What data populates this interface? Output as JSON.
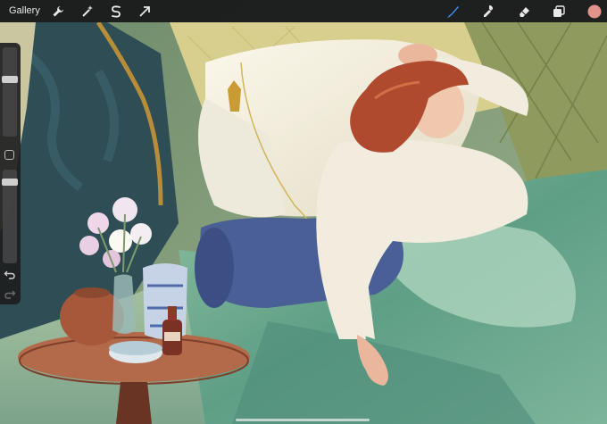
{
  "app": {
    "gallery_label": "Gallery",
    "current_color": "#e0938a",
    "accent_color": "#3a8ff5"
  },
  "toolbar": {
    "left_tools": [
      {
        "icon": "wrench-icon",
        "name": "actions"
      },
      {
        "icon": "magic-wand-icon",
        "name": "adjustments"
      },
      {
        "icon": "selection-s-icon",
        "name": "selection"
      },
      {
        "icon": "arrow-cursor-icon",
        "name": "transform"
      }
    ],
    "right_tools": [
      {
        "icon": "brush-icon",
        "name": "paint",
        "active": true
      },
      {
        "icon": "smudge-icon",
        "name": "smudge"
      },
      {
        "icon": "eraser-icon",
        "name": "eraser"
      },
      {
        "icon": "layers-icon",
        "name": "layers"
      },
      {
        "icon": "color-swatch-icon",
        "name": "colors"
      }
    ]
  },
  "sidebar": {
    "brush_size_level": 0.35,
    "opacity_level": 0.1,
    "controls": [
      {
        "icon": "brush-size-slider",
        "name": "size"
      },
      {
        "icon": "modify-square-icon",
        "name": "modify"
      },
      {
        "icon": "opacity-slider",
        "name": "opacity"
      },
      {
        "icon": "undo-icon",
        "name": "undo"
      },
      {
        "icon": "redo-icon",
        "name": "redo"
      }
    ]
  }
}
